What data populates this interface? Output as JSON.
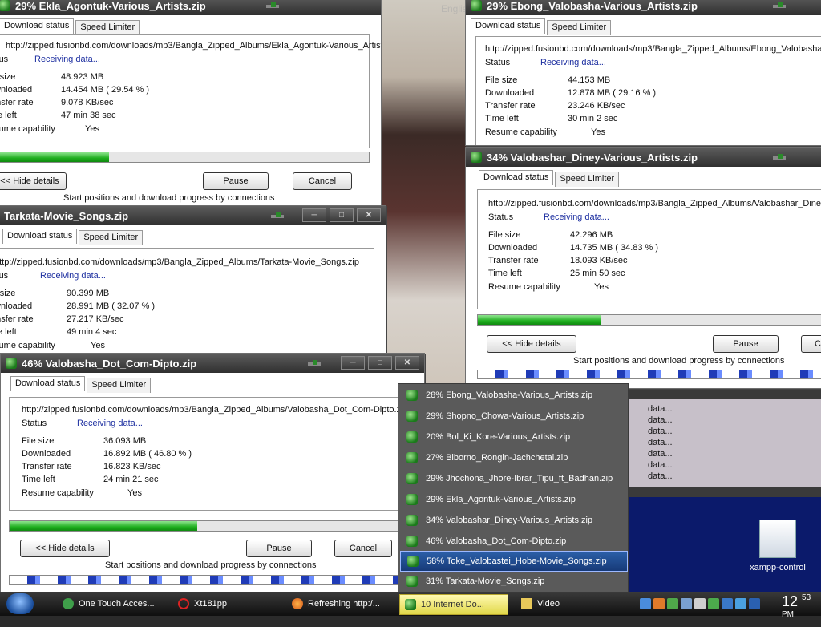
{
  "windows": {
    "ekla": {
      "title": "29% Ekla_Agontuk-Various_Artists.zip",
      "tab_active": "Download status",
      "tab_other": "Speed Limiter",
      "url": "http://zipped.fusionbd.com/downloads/mp3/Bangla_Zipped_Albums/Ekla_Agontuk-Various_Artists.",
      "status_label": "Status",
      "status_value": "Receiving data...",
      "file_size_label": "File size",
      "file_size": "48.923  MB",
      "downloaded_label": "Downloaded",
      "downloaded": "14.454  MB  ( 29.54 % )",
      "rate_label": "Transfer rate",
      "rate": "9.078  KB/sec",
      "time_label": "Time left",
      "time": "47 min 38 sec",
      "resume_label": "Resume capability",
      "resume": "Yes",
      "progress": 0.2954,
      "hide_btn": "<< Hide details",
      "pause_btn": "Pause",
      "cancel_btn": "Cancel",
      "caption": "Start positions and download progress by connections"
    },
    "tarkata": {
      "title": "Tarkata-Movie_Songs.zip",
      "tab_active": "Download status",
      "tab_other": "Speed Limiter",
      "url": "http://zipped.fusionbd.com/downloads/mp3/Bangla_Zipped_Albums/Tarkata-Movie_Songs.zip",
      "status_label": "Status",
      "status_value": "Receiving data...",
      "file_size_label": "File size",
      "file_size": "90.399  MB",
      "downloaded_label": "Downloaded",
      "downloaded": "28.991  MB  ( 32.07 % )",
      "rate_label": "Transfer rate",
      "rate": "27.217  KB/sec",
      "time_label": "Time left",
      "time": "49 min 4 sec",
      "resume_label": "Resume capability",
      "resume": "Yes"
    },
    "dipto": {
      "title": "46% Valobasha_Dot_Com-Dipto.zip",
      "tab_active": "Download status",
      "tab_other": "Speed Limiter",
      "url": "http://zipped.fusionbd.com/downloads/mp3/Bangla_Zipped_Albums/Valobasha_Dot_Com-Dipto.zi",
      "status_label": "Status",
      "status_value": "Receiving data...",
      "file_size_label": "File size",
      "file_size": "36.093  MB",
      "downloaded_label": "Downloaded",
      "downloaded": "16.892  MB  ( 46.80 % )",
      "rate_label": "Transfer rate",
      "rate": "16.823  KB/sec",
      "time_label": "Time left",
      "time": "24 min 21 sec",
      "resume_label": "Resume capability",
      "resume": "Yes",
      "progress": 0.468,
      "hide_btn": "<< Hide details",
      "pause_btn": "Pause",
      "cancel_btn": "Cancel",
      "caption": "Start positions and download progress by connections"
    },
    "ebong": {
      "title": "29% Ebong_Valobasha-Various_Artists.zip",
      "tab_active": "Download status",
      "tab_other": "Speed Limiter",
      "url": "http://zipped.fusionbd.com/downloads/mp3/Bangla_Zipped_Albums/Ebong_Valobasha",
      "status_label": "Status",
      "status_value": "Receiving data...",
      "file_size_label": "File size",
      "file_size": "44.153  MB",
      "downloaded_label": "Downloaded",
      "downloaded": "12.878  MB  ( 29.16 % )",
      "rate_label": "Transfer rate",
      "rate": "23.246  KB/sec",
      "time_label": "Time left",
      "time": "30 min 2 sec",
      "resume_label": "Resume capability",
      "resume": "Yes"
    },
    "diney": {
      "title": "34% Valobashar_Diney-Various_Artists.zip",
      "tab_active": "Download status",
      "tab_other": "Speed Limiter",
      "url": "http://zipped.fusionbd.com/downloads/mp3/Bangla_Zipped_Albums/Valobashar_Diney",
      "status_label": "Status",
      "status_value": "Receiving data...",
      "file_size_label": "File size",
      "file_size": "42.296  MB",
      "downloaded_label": "Downloaded",
      "downloaded": "14.735  MB  ( 34.83 % )",
      "rate_label": "Transfer rate",
      "rate": "18.093  KB/sec",
      "time_label": "Time left",
      "time": "25 min 50 sec",
      "resume_label": "Resume capability",
      "resume": "Yes",
      "progress": 0.3483,
      "hide_btn": "<< Hide details",
      "pause_btn": "Pause",
      "cancel_btn": "C",
      "caption": "Start positions and download progress by connections"
    }
  },
  "popup_items": [
    "28% Ebong_Valobasha-Various_Artists.zip",
    "29% Shopno_Chowa-Various_Artists.zip",
    "20% Bol_Ki_Kore-Various_Artists.zip",
    "27% Biborno_Rongin-Jachchetai.zip",
    "29% Jhochona_Jhore-Ibrar_Tipu_ft_Badhan.zip",
    "29% Ekla_Agontuk-Various_Artists.zip",
    "34% Valobashar_Diney-Various_Artists.zip",
    "46% Valobasha_Dot_Com-Dipto.zip",
    "58% Toke_Valobastei_Hobe-Movie_Songs.zip",
    "31% Tarkata-Movie_Songs.zip"
  ],
  "popup_selected_index": 8,
  "data_lines": [
    "data...",
    "data...",
    "data...",
    "data...",
    "data...",
    "data...",
    "data..."
  ],
  "desktop": {
    "xampp_label": "xampp-control",
    "language": "English"
  },
  "taskbar": {
    "items": [
      "One Touch Acces...",
      "Xt181pp",
      "Refreshing http:/...",
      "10 Internet Do...",
      "Video"
    ],
    "clock": "12",
    "clock_min": "53",
    "clock_ampm": "PM"
  }
}
